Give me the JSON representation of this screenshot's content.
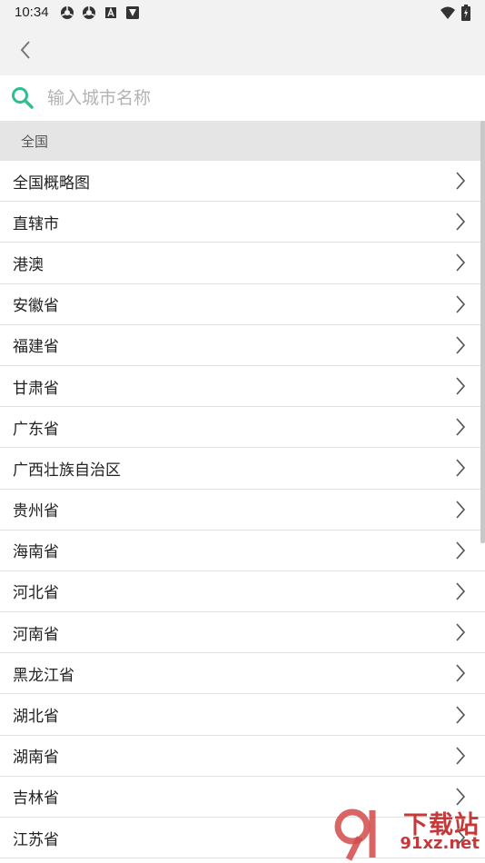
{
  "status_bar": {
    "time": "10:34",
    "left_icons": [
      "vpn-icon",
      "vpn-icon",
      "a-icon",
      "app-icon"
    ],
    "right_icons": [
      "wifi-icon",
      "battery-charging-icon"
    ]
  },
  "app_bar": {
    "back_icon": "chevron-left-icon"
  },
  "search": {
    "placeholder": "输入城市名称",
    "value": "",
    "icon": "search-icon",
    "icon_color": "#2bbf92"
  },
  "section": {
    "title": "全国"
  },
  "regions": [
    "全国概略图",
    "直辖市",
    "港澳",
    "安徽省",
    "福建省",
    "甘肃省",
    "广东省",
    "广西壮族自治区",
    "贵州省",
    "海南省",
    "河北省",
    "河南省",
    "黑龙江省",
    "湖北省",
    "湖南省",
    "吉林省",
    "江苏省"
  ],
  "watermark": {
    "top": "下载站",
    "bottom": "91xz.net"
  }
}
